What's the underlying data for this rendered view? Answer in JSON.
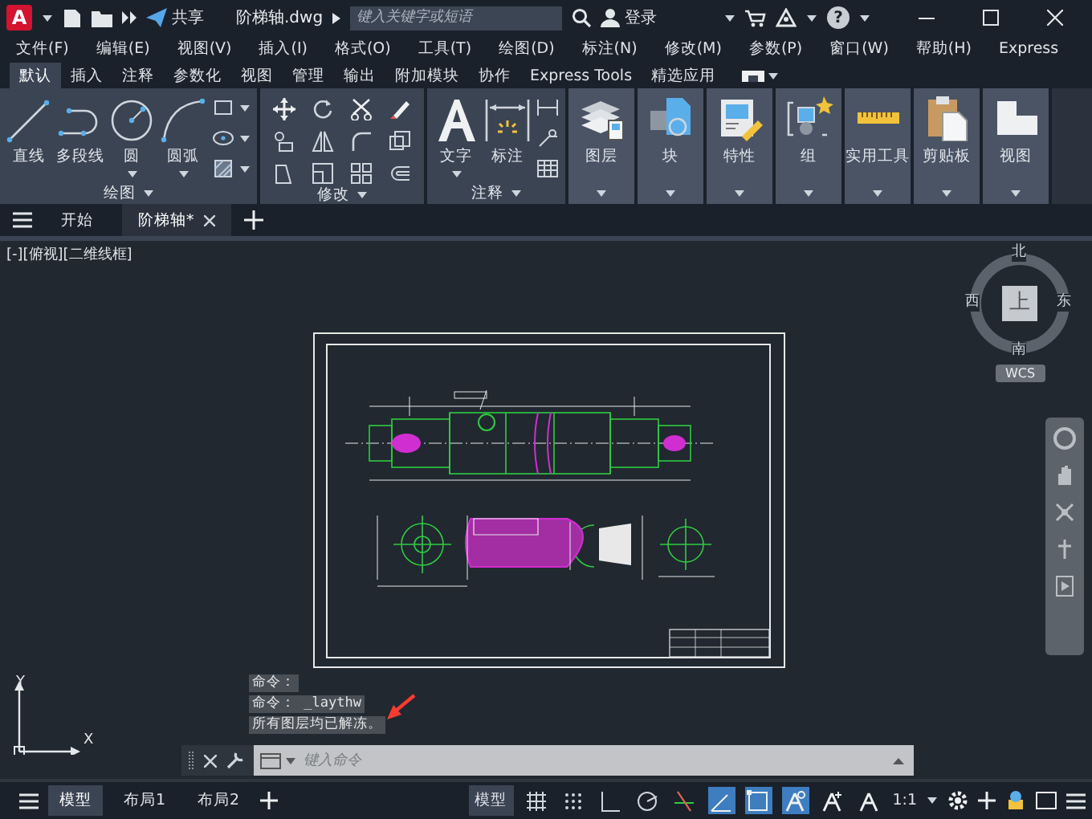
{
  "title_bar": {
    "logo": "A",
    "share_label": "共享",
    "file_name": "阶梯轴.dwg",
    "search": {
      "placeholder": "键入关键字或短语"
    },
    "user_label": "登录",
    "help": "?"
  },
  "menu_bar": [
    "文件(F)",
    "编辑(E)",
    "视图(V)",
    "插入(I)",
    "格式(O)",
    "工具(T)",
    "绘图(D)",
    "标注(N)",
    "修改(M)",
    "参数(P)",
    "窗口(W)",
    "帮助(H)",
    "Express"
  ],
  "ribbon_tabs": [
    {
      "label": "默认",
      "selected": true
    },
    {
      "label": "插入",
      "selected": false
    },
    {
      "label": "注释",
      "selected": false
    },
    {
      "label": "参数化",
      "selected": false
    },
    {
      "label": "视图",
      "selected": false
    },
    {
      "label": "管理",
      "selected": false
    },
    {
      "label": "输出",
      "selected": false
    },
    {
      "label": "附加模块",
      "selected": false
    },
    {
      "label": "协作",
      "selected": false
    },
    {
      "label": "Express Tools",
      "selected": false
    },
    {
      "label": "精选应用",
      "selected": false
    }
  ],
  "ribbon_panels": [
    {
      "title": "绘图",
      "kind": "draw",
      "tools": [
        {
          "label": "直线",
          "kind": "line"
        },
        {
          "label": "多段线",
          "kind": "polyline"
        },
        {
          "label": "圆",
          "kind": "circle"
        },
        {
          "label": "圆弧",
          "kind": "arc"
        }
      ]
    },
    {
      "title": "修改",
      "kind": "modify"
    },
    {
      "title": "注释",
      "kind": "annotate",
      "tools": [
        {
          "label": "文字",
          "kind": "text"
        },
        {
          "label": "标注",
          "kind": "dimension"
        }
      ]
    }
  ],
  "ribbon_buttons": [
    {
      "label": "图层",
      "kind": "layers"
    },
    {
      "label": "块",
      "kind": "block"
    },
    {
      "label": "特性",
      "kind": "properties"
    },
    {
      "label": "组",
      "kind": "group"
    },
    {
      "label": "实用工具",
      "kind": "utilities"
    },
    {
      "label": "剪贴板",
      "kind": "clipboard"
    },
    {
      "label": "视图",
      "kind": "view"
    }
  ],
  "document_tabs": [
    {
      "label": "开始",
      "selected": false
    },
    {
      "label": "阶梯轴*",
      "selected": true
    }
  ],
  "viewport": {
    "view_label": "[-][俯视][二维线框]",
    "viewcube": {
      "north": "北",
      "west": "西",
      "top": "上",
      "east": "东",
      "south": "南",
      "ucs": "WCS"
    },
    "ucs_axes": {
      "x": "X",
      "y": "Y"
    }
  },
  "command_history": [
    "命令：",
    "命令： _laythw",
    "所有图层均已解冻。"
  ],
  "command_input": {
    "placeholder": "键入命令"
  },
  "layout_tabs": [
    {
      "label": "模型",
      "selected": true
    },
    {
      "label": "布局1",
      "selected": false
    },
    {
      "label": "布局2",
      "selected": false
    }
  ],
  "status_bar": {
    "model_label": "模型",
    "scale": "1:1",
    "tools": [
      {
        "kind": "grid",
        "on": false
      },
      {
        "kind": "snap",
        "on": false
      },
      {
        "kind": "ortho",
        "on": false
      },
      {
        "kind": "polar",
        "on": false
      },
      {
        "kind": "track",
        "on": false
      },
      {
        "kind": "angle",
        "on": true
      },
      {
        "kind": "osnap",
        "on": true
      },
      {
        "kind": "annotation",
        "on": true
      },
      {
        "kind": "autoscale",
        "on": false
      },
      {
        "kind": "annoscale",
        "on": false
      }
    ]
  }
}
